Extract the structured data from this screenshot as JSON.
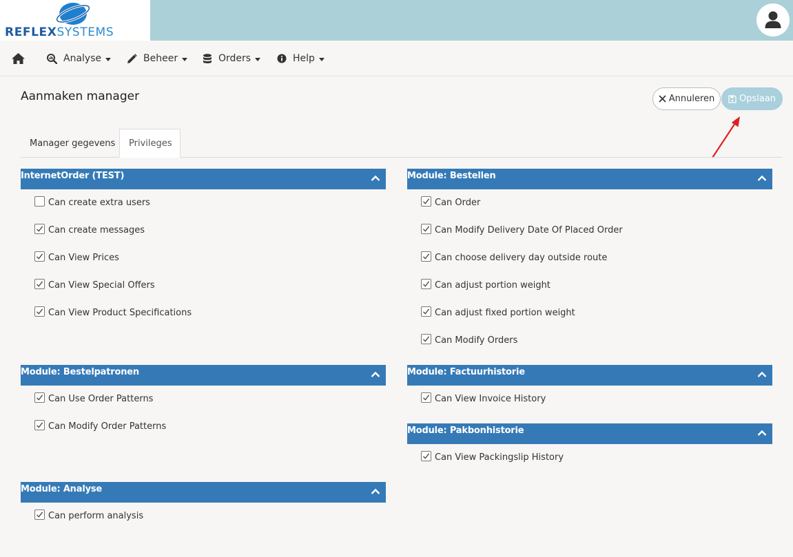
{
  "brand": {
    "part1": "REFLEX",
    "part2": "SYSTEMS"
  },
  "user": {
    "icon": "user-icon"
  },
  "nav": [
    {
      "label": "",
      "icon": "home-icon"
    },
    {
      "label": "Analyse",
      "icon": "search-chart-icon"
    },
    {
      "label": "Beheer",
      "icon": "pencil-icon"
    },
    {
      "label": "Orders",
      "icon": "database-icon"
    },
    {
      "label": "Help",
      "icon": "info-icon"
    }
  ],
  "page": {
    "title": "Aanmaken manager",
    "cancel_label": "Annuleren",
    "save_label": "Opslaan"
  },
  "tabs": [
    {
      "label": "Manager gegevens"
    },
    {
      "label": "Privileges"
    }
  ],
  "sections": [
    {
      "title": "InternetOrder (TEST)",
      "items": [
        {
          "label": "Can create extra users",
          "checked": false
        },
        {
          "label": "Can create messages",
          "checked": true
        },
        {
          "label": "Can View Prices",
          "checked": true
        },
        {
          "label": "Can View Special Offers",
          "checked": true
        },
        {
          "label": "Can View Product Specifications",
          "checked": true
        }
      ]
    },
    {
      "title": "Module: Bestellen",
      "items": [
        {
          "label": "Can Order",
          "checked": true
        },
        {
          "label": "Can Modify Delivery Date Of Placed Order",
          "checked": true
        },
        {
          "label": "Can choose delivery day outside route",
          "checked": true
        },
        {
          "label": "Can adjust portion weight",
          "checked": true
        },
        {
          "label": "Can adjust fixed portion weight",
          "checked": true
        },
        {
          "label": "Can Modify Orders",
          "checked": true
        }
      ]
    },
    {
      "title": "Module: Bestelpatronen",
      "items": [
        {
          "label": "Can Use Order Patterns",
          "checked": true
        },
        {
          "label": "Can Modify Order Patterns",
          "checked": true
        }
      ]
    },
    {
      "title": "Module: Factuurhistorie",
      "items": [
        {
          "label": "Can View Invoice History",
          "checked": true
        }
      ]
    },
    {
      "title": "Module: Pakbonhistorie",
      "items": [
        {
          "label": "Can View Packingslip History",
          "checked": true
        }
      ]
    },
    {
      "title": "Module: Analyse",
      "items": [
        {
          "label": "Can perform analysis",
          "checked": true
        }
      ]
    }
  ],
  "colors": {
    "header_bg": "#abd0d7",
    "section_header": "#357ab7",
    "save_button": "#a9d0dc",
    "annotation_arrow": "#e02020"
  }
}
